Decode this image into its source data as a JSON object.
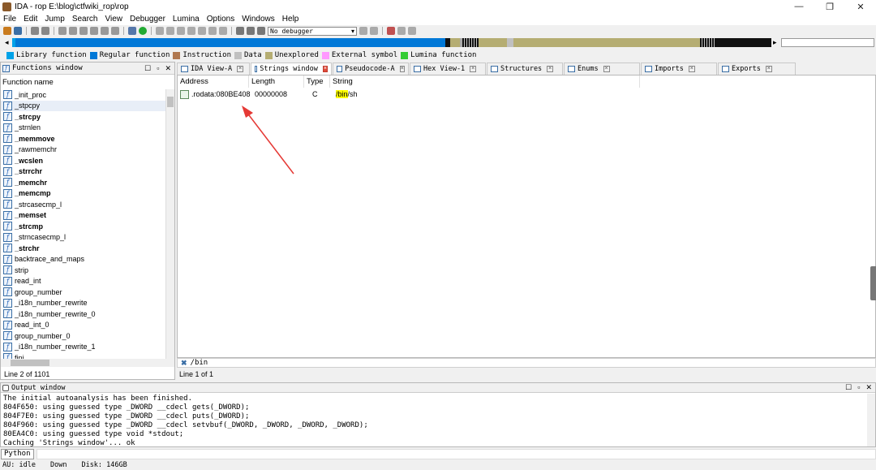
{
  "window": {
    "title": "IDA - rop E:\\blog\\ctfwiki_rop\\rop",
    "minimize": "—",
    "maximize": "❐",
    "close": "✕"
  },
  "menu": [
    "File",
    "Edit",
    "Jump",
    "Search",
    "View",
    "Debugger",
    "Lumina",
    "Options",
    "Windows",
    "Help"
  ],
  "toolbar": {
    "debugger_select": "No debugger"
  },
  "legend": [
    {
      "label": "Library function",
      "color": "#00a2e8"
    },
    {
      "label": "Regular function",
      "color": "#0078d7"
    },
    {
      "label": "Instruction",
      "color": "#b07850"
    },
    {
      "label": "Data",
      "color": "#c0c0c0"
    },
    {
      "label": "Unexplored",
      "color": "#b5ad72"
    },
    {
      "label": "External symbol",
      "color": "#ff99ff"
    },
    {
      "label": "Lumina function",
      "color": "#33cc33"
    }
  ],
  "functions_panel": {
    "title": "Functions window",
    "column": "Function name",
    "items": [
      {
        "name": "_init_proc",
        "bold": false
      },
      {
        "name": "_stpcpy",
        "bold": false
      },
      {
        "name": "_strcpy",
        "bold": true
      },
      {
        "name": "_strnlen",
        "bold": false
      },
      {
        "name": "_memmove",
        "bold": true
      },
      {
        "name": "_rawmemchr",
        "bold": false
      },
      {
        "name": "_wcslen",
        "bold": true
      },
      {
        "name": "_strrchr",
        "bold": true
      },
      {
        "name": "_memchr",
        "bold": true
      },
      {
        "name": "_memcmp",
        "bold": true
      },
      {
        "name": "_strcasecmp_l",
        "bold": false
      },
      {
        "name": "_memset",
        "bold": true
      },
      {
        "name": "_strcmp",
        "bold": true
      },
      {
        "name": "_strncasecmp_l",
        "bold": false
      },
      {
        "name": "_strchr",
        "bold": true
      },
      {
        "name": "backtrace_and_maps",
        "bold": false
      },
      {
        "name": "strip",
        "bold": false
      },
      {
        "name": "read_int",
        "bold": false
      },
      {
        "name": "group_number",
        "bold": false
      },
      {
        "name": "_i18n_number_rewrite",
        "bold": false
      },
      {
        "name": "_i18n_number_rewrite_0",
        "bold": false
      },
      {
        "name": "read_int_0",
        "bold": false
      },
      {
        "name": "group_number_0",
        "bold": false
      },
      {
        "name": "_i18n_number_rewrite_1",
        "bold": false
      },
      {
        "name": "fini",
        "bold": false
      }
    ],
    "selected_index": 1,
    "status": "Line 2 of 1101"
  },
  "tabs": [
    {
      "label": "IDA View-A",
      "active": false,
      "close_red": false
    },
    {
      "label": "Strings window",
      "active": true,
      "close_red": true
    },
    {
      "label": "Pseudocode-A",
      "active": false,
      "close_red": false
    },
    {
      "label": "Hex View-1",
      "active": false,
      "close_red": false
    },
    {
      "label": "Structures",
      "active": false,
      "close_red": false
    },
    {
      "label": "Enums",
      "active": false,
      "close_red": false
    },
    {
      "label": "Imports",
      "active": false,
      "close_red": false
    },
    {
      "label": "Exports",
      "active": false,
      "close_red": false
    }
  ],
  "strings_window": {
    "columns": [
      "Address",
      "Length",
      "Type",
      "String"
    ],
    "row": {
      "address": ".rodata:080BE408",
      "length": "00000008",
      "type": "C",
      "string_hl": "/bin",
      "string_rest": "/sh"
    },
    "filter": "/bin",
    "status": "Line 1 of 1"
  },
  "output": {
    "title": "Output window",
    "lines": [
      "The initial autoanalysis has been finished.",
      "804F650: using guessed type _DWORD __cdecl gets(_DWORD);",
      "804F7E0: using guessed type _DWORD __cdecl puts(_DWORD);",
      "804F960: using guessed type _DWORD __cdecl setvbuf(_DWORD, _DWORD, _DWORD, _DWORD);",
      "80EA4C0: using guessed type void *stdout;",
      "Caching 'Strings window'... ok"
    ]
  },
  "python_button": "Python",
  "statusbar": {
    "au": "AU:",
    "state": "idle",
    "dir": "Down",
    "disk": "Disk: 146GB"
  }
}
